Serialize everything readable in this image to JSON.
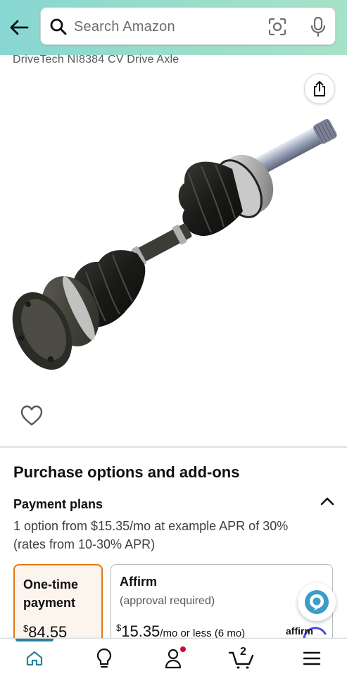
{
  "search": {
    "placeholder": "Search Amazon"
  },
  "product": {
    "title": "DriveTech NI8384 CV Drive Axle"
  },
  "purchase": {
    "section_title": "Purchase options and add-ons",
    "payment_plans_title": "Payment plans",
    "payment_plans_desc": "1 option from $15.35/mo at example APR of 30% (rates from 10-30% APR)",
    "option1": {
      "title": "One-time payment",
      "currency": "$",
      "price": "84.55"
    },
    "option2": {
      "title": "Affirm",
      "subtitle": "(approval required)",
      "currency": "$",
      "price": "15.35",
      "price_suffix": "/mo or less (6 mo)",
      "brand": "affirm"
    }
  },
  "nav": {
    "cart_count": "2"
  },
  "colors": {
    "accent": "#e47911",
    "teal": "#2a7fa3",
    "header": "#98dccb"
  }
}
